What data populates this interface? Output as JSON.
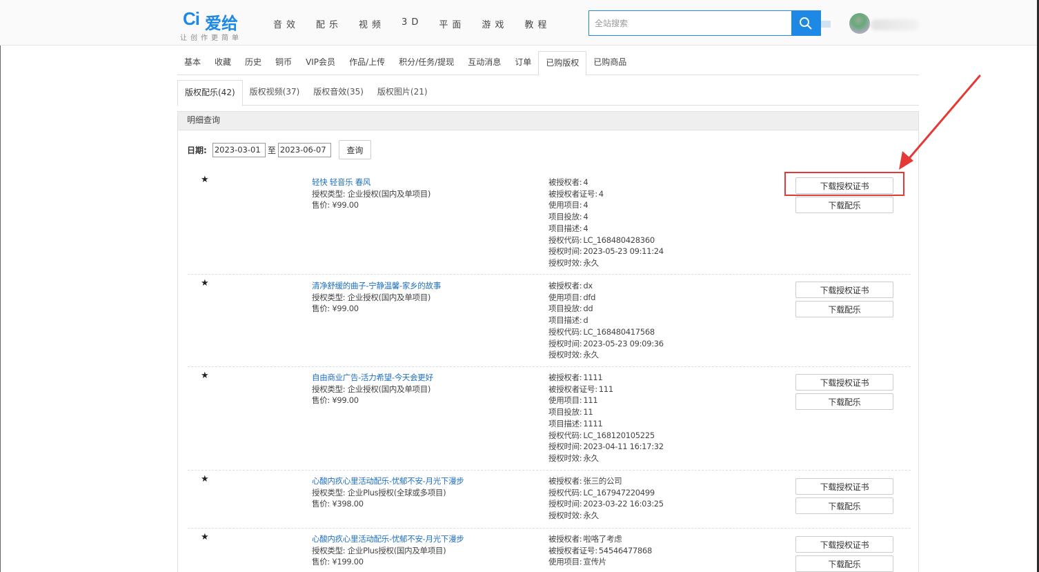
{
  "header": {
    "logo_mark": "Ci",
    "logo_text": "爱给",
    "logo_slogan": "让创作更简单",
    "nav": [
      "音效",
      "配乐",
      "视频",
      "3D",
      "平面",
      "游戏",
      "教程"
    ],
    "search_placeholder": "全站搜索",
    "accent_color": "#1e88e5"
  },
  "main_tabs": [
    "基本",
    "收藏",
    "历史",
    "铜币",
    "VIP会员",
    "作品/上传",
    "积分/任务/提现",
    "互动消息",
    "订单",
    "已购版权",
    "已购商品"
  ],
  "main_tab_active": "已购版权",
  "sub_tabs": [
    "版权配乐(42)",
    "版权视频(37)",
    "版权音效(35)",
    "版权图片(21)"
  ],
  "sub_tab_active": "版权配乐(42)",
  "panel": {
    "title": "明细查询",
    "date_label": "日期:",
    "date_from": "2023-03-01",
    "to_label": "至",
    "date_to": "2023-06-07",
    "query_label": "查询"
  },
  "buttons": {
    "download_cert": "下载授权证书",
    "download_music": "下载配乐"
  },
  "records": [
    {
      "star": "★",
      "title": "轻快 轻音乐 春风",
      "license_type": "授权类型: 企业授权(国内及单项目)",
      "price": "售价:  ¥99.00",
      "fields": [
        [
          "被授权者:",
          "4"
        ],
        [
          "被授权者证号:",
          "4"
        ],
        [
          "使用项目:",
          "4"
        ],
        [
          "项目投放:",
          "4"
        ],
        [
          "项目描述:",
          "4"
        ],
        [
          "授权代码:",
          "LC_168480428360"
        ],
        [
          "授权时间:",
          "2023-05-23 09:11:24"
        ],
        [
          "授权时效:",
          "永久"
        ]
      ]
    },
    {
      "star": "★",
      "title": "清净舒缓的曲子-宁静温馨-家乡的故事",
      "license_type": "授权类型: 企业授权(国内及单项目)",
      "price": "售价:  ¥99.00",
      "fields": [
        [
          "被授权者:",
          "dx"
        ],
        [
          "使用项目:",
          "dfd"
        ],
        [
          "项目投放:",
          "dd"
        ],
        [
          "项目描述:",
          "d"
        ],
        [
          "授权代码:",
          "LC_168480417568"
        ],
        [
          "授权时间:",
          "2023-05-23 09:09:36"
        ],
        [
          "授权时效:",
          "永久"
        ]
      ]
    },
    {
      "star": "★",
      "title": "自由商业广告-活力希望-今天会更好",
      "license_type": "授权类型: 企业授权(国内及单项目)",
      "price": "售价:  ¥99.00",
      "fields": [
        [
          "被授权者:",
          "1111"
        ],
        [
          "被授权者证号:",
          "111"
        ],
        [
          "使用项目:",
          "111"
        ],
        [
          "项目投放:",
          "11"
        ],
        [
          "项目描述:",
          "1111"
        ],
        [
          "授权代码:",
          "LC_168120105225"
        ],
        [
          "授权时间:",
          "2023-04-11 16:17:32"
        ],
        [
          "授权时效:",
          "永久"
        ]
      ]
    },
    {
      "star": "★",
      "title": "心酸内疚心里活动配乐-忧郁不安-月光下漫步",
      "license_type": "授权类型: 企业Plus授权(全球或多项目)",
      "price": "售价:  ¥398.00",
      "fields": [
        [
          "被授权者:",
          "张三的公司"
        ],
        [
          "授权代码:",
          "LC_167947220499"
        ],
        [
          "授权时间:",
          "2023-03-22 16:03:25"
        ],
        [
          "授权时效:",
          "永久"
        ]
      ]
    },
    {
      "star": "★",
      "title": "心酸内疚心里活动配乐-忧郁不安-月光下漫步",
      "license_type": "授权类型: 企业Plus授权(国内及单项目)",
      "price": "售价:  ¥199.00",
      "fields": [
        [
          "被授权者:",
          "啦咯了考虑"
        ],
        [
          "被授权者证号:",
          "54546477868"
        ],
        [
          "使用项目:",
          "宣传片"
        ]
      ]
    }
  ]
}
